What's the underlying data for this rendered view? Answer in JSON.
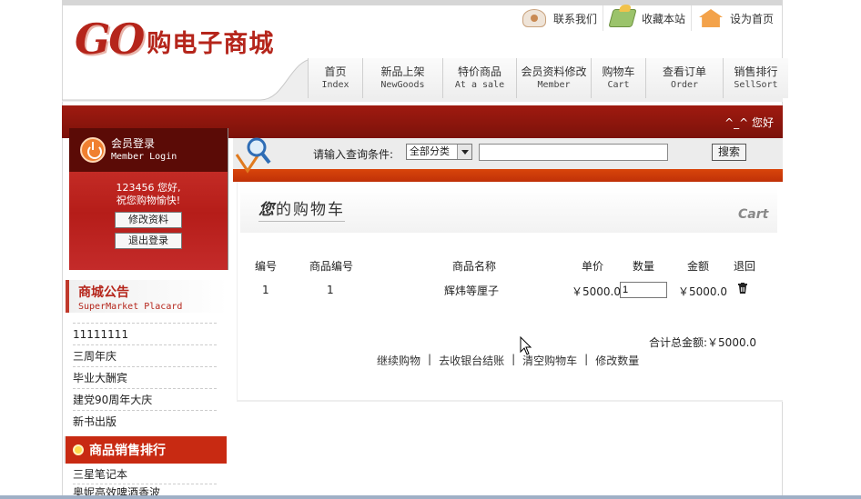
{
  "header": {
    "logo_latin": "GO",
    "logo_cn": "购电子商城",
    "top_links": [
      "联系我们",
      "收藏本站",
      "设为首页"
    ]
  },
  "nav": [
    {
      "cn": "首页",
      "en": "Index",
      "width": 0
    },
    {
      "cn": "新品上架",
      "en": "NewGoods",
      "width": 0
    },
    {
      "cn": "特价商品",
      "en": "At a sale",
      "width": 0
    },
    {
      "cn": "会员资料修改",
      "en": "Member",
      "width": 0
    },
    {
      "cn": "购物车",
      "en": "Cart",
      "width": 0
    },
    {
      "cn": "查看订单",
      "en": "Order",
      "width": 0
    },
    {
      "cn": "销售排行",
      "en": "SellSort",
      "width": 0
    }
  ],
  "redbar": {
    "text": "^_^ 您好"
  },
  "login": {
    "title_cn": "会员登录",
    "title_en": "Member Login",
    "greeting": "123456 您好,",
    "wish": "祝您购物愉快!",
    "edit_profile": "修改资料",
    "logout": "退出登录"
  },
  "notice": {
    "title_cn": "商城公告",
    "title_en": "SuperMarket Placard",
    "items": [
      "11111111",
      "三周年庆",
      "毕业大酬宾",
      "建党90周年大庆",
      "新书出版"
    ]
  },
  "ranking": {
    "title": "商品销售排行",
    "items": [
      "三星笔记本",
      "奥妮高效啤酒香波"
    ]
  },
  "search": {
    "label": "请输入查询条件:",
    "category": "全部分类",
    "query": "",
    "button": "搜索"
  },
  "cart": {
    "title_bold": "您",
    "title_rest": "的购物车",
    "title_en": "Cart",
    "columns": [
      "编号",
      "商品编号",
      "商品名称",
      "单价",
      "数量",
      "金额",
      "退回"
    ],
    "rows": [
      {
        "no": "1",
        "goods_id": "1",
        "name": "辉炜等厘子",
        "price": "￥5000.0",
        "qty": "1",
        "amount": "￥5000.0"
      }
    ],
    "total_label": "合计总金额:￥5000.0",
    "actions": [
      "继续购物",
      "去收银台结账",
      "清空购物车",
      "修改数量"
    ]
  }
}
